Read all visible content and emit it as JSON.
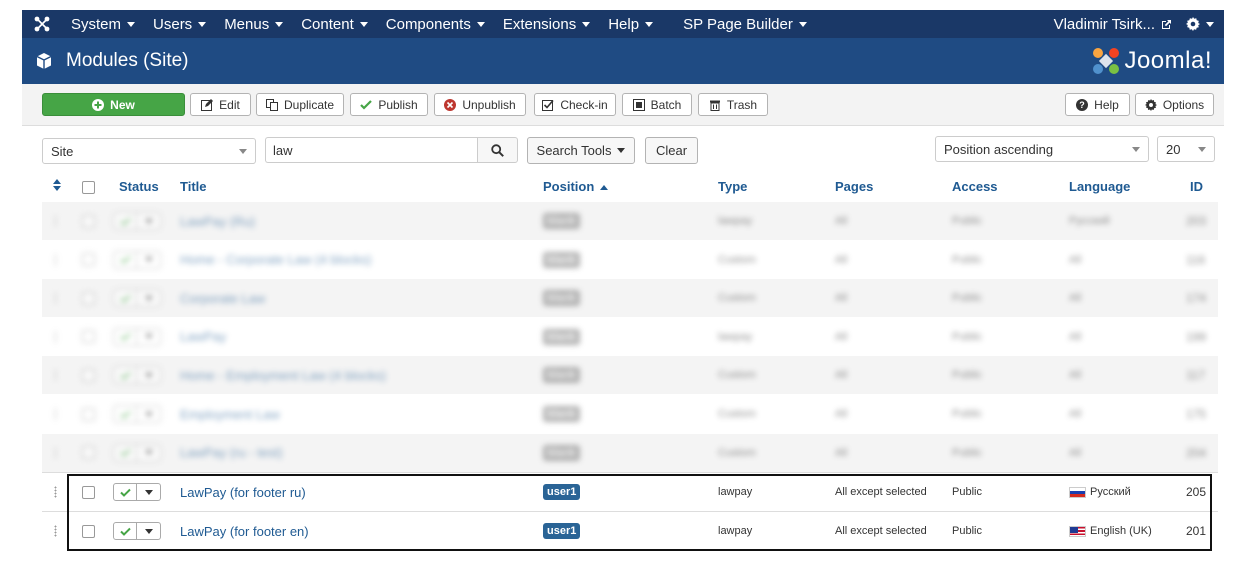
{
  "menubar": {
    "items": [
      "System",
      "Users",
      "Menus",
      "Content",
      "Components",
      "Extensions",
      "Help",
      "SP Page Builder"
    ],
    "user": "Vladimir Tsirk..."
  },
  "header": {
    "title": "Modules (Site)",
    "brand": "Joomla!"
  },
  "toolbar": {
    "new": "New",
    "edit": "Edit",
    "duplicate": "Duplicate",
    "publish": "Publish",
    "unpublish": "Unpublish",
    "checkin": "Check-in",
    "batch": "Batch",
    "trash": "Trash",
    "help": "Help",
    "options": "Options"
  },
  "filters": {
    "client": "Site",
    "search_value": "law",
    "search_tools": "Search Tools",
    "clear": "Clear",
    "ordering": "Position ascending",
    "limit": "20"
  },
  "table": {
    "headers": {
      "status": "Status",
      "title": "Title",
      "position": "Position",
      "type": "Type",
      "pages": "Pages",
      "access": "Access",
      "language": "Language",
      "id": "ID"
    },
    "blurred_rows": [
      {
        "title": "LawPay (Ru)",
        "position": "blank",
        "type": "lawpay",
        "pages": "All",
        "access": "Public",
        "language": "Русский",
        "id": "203"
      },
      {
        "title": "Home - Corporate Law (4 blocks)",
        "position": "blank",
        "type": "Custom",
        "pages": "All",
        "access": "Public",
        "language": "All",
        "id": "116"
      },
      {
        "title": "Corporate Law",
        "position": "blank",
        "type": "Custom",
        "pages": "All",
        "access": "Public",
        "language": "All",
        "id": "174"
      },
      {
        "title": "LawPay",
        "position": "blank",
        "type": "lawpay",
        "pages": "All",
        "access": "Public",
        "language": "All",
        "id": "199"
      },
      {
        "title": "Home - Employment Law (4 blocks)",
        "position": "blank",
        "type": "Custom",
        "pages": "All",
        "access": "Public",
        "language": "All",
        "id": "117"
      },
      {
        "title": "Employment Law",
        "position": "blank",
        "type": "Custom",
        "pages": "All",
        "access": "Public",
        "language": "All",
        "id": "175"
      },
      {
        "title": "LawPay (ru - test)",
        "position": "blank",
        "type": "Custom",
        "pages": "All",
        "access": "Public",
        "language": "All",
        "id": "204"
      }
    ],
    "rows": [
      {
        "title": "LawPay (for footer ru)",
        "position": "user1",
        "type": "lawpay",
        "pages": "All except selected",
        "access": "Public",
        "language": "Русский",
        "flag": "ru",
        "id": "205"
      },
      {
        "title": "LawPay (for footer en)",
        "position": "user1",
        "type": "lawpay",
        "pages": "All except selected",
        "access": "Public",
        "language": "English (UK)",
        "flag": "uk",
        "id": "201"
      }
    ]
  }
}
